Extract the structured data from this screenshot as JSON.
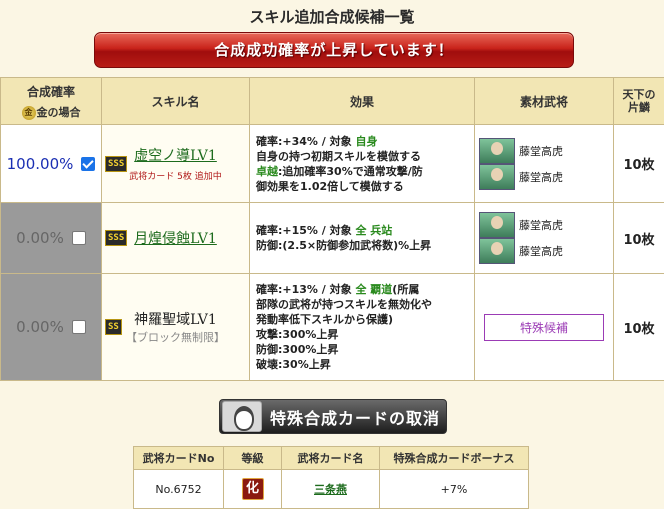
{
  "page_title": "スキル追加合成候補一覧",
  "banner": "合成成功確率が上昇しています！",
  "headers": {
    "rate": "合成確率",
    "gold_icon": "金",
    "gold_case": "金の場合",
    "skill_name": "スキル名",
    "effect": "効果",
    "material": "素材武将",
    "tenka": "天下の",
    "tenka2": "片鱗"
  },
  "rows": [
    {
      "rate": "100.00%",
      "checked": true,
      "rank": "SSS",
      "skill": "虚空ノ導LV1",
      "sub": "武将カード 5枚 追加中",
      "effect_lines": [
        {
          "a": "確率:+34% / 対象 ",
          "b": "自身"
        },
        {
          "a": "自身の持つ初期スキルを模倣する",
          "b": ""
        },
        {
          "a": "",
          "b": "卓越",
          "c": ":追加確率30%で通常攻撃/防"
        },
        {
          "a": "御効果を1.02倍して模倣する",
          "b": ""
        }
      ],
      "materials": [
        "藤堂高虎",
        "藤堂高虎"
      ],
      "count": "10枚"
    },
    {
      "rate": "0.00%",
      "checked": false,
      "rank": "SSS",
      "skill": "月煌侵蝕LV1",
      "effect_lines": [
        {
          "a": "確率:+15% / 対象 ",
          "b": "全 兵站"
        },
        {
          "a": "防御:(2.5×防御参加武将数)%上昇",
          "b": ""
        }
      ],
      "materials": [
        "藤堂高虎",
        "藤堂高虎"
      ],
      "count": "10枚"
    },
    {
      "rate": "0.00%",
      "checked": false,
      "rank": "SS",
      "skill": "神羅聖域LV1",
      "sub": "【ブロック無制限】",
      "effect_lines": [
        {
          "a": "確率:+13% / 対象 ",
          "b": "全 覇道",
          "c": "(所属"
        },
        {
          "a": "部隊の武将が持つスキルを無効化や",
          "b": ""
        },
        {
          "a": "発動率低下スキルから保護)",
          "b": ""
        },
        {
          "a": "攻撃:300%上昇",
          "b": ""
        },
        {
          "a": "防御:300%上昇",
          "b": ""
        },
        {
          "a": "破壊:30%上昇",
          "b": ""
        }
      ],
      "special": "特殊候補",
      "count": "10枚"
    }
  ],
  "cancel_button": "特殊合成カードの取消",
  "card_table": {
    "headers": [
      "武将カードNo",
      "等級",
      "武将カード名",
      "特殊合成カードボーナス"
    ],
    "row": {
      "no": "No.6752",
      "grade": "化",
      "name": "三条燕",
      "bonus": "+7%"
    }
  }
}
